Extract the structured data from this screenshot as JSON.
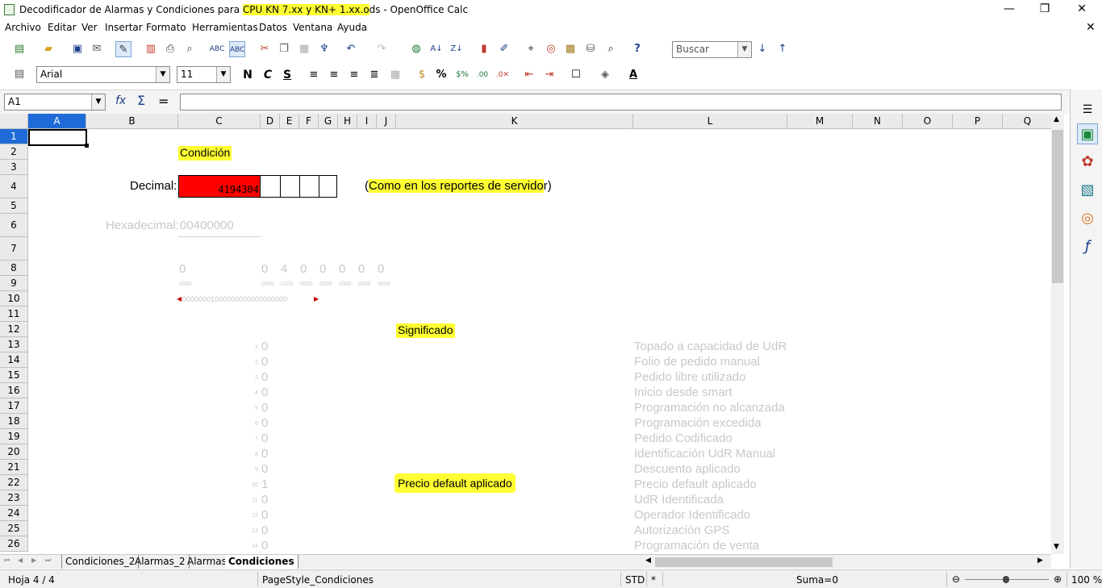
{
  "window": {
    "title_pre": "Decodificador de Alarmas y Condiciones para ",
    "title_hl": "CPU KN 7.xx y KN+ 1.xx.o",
    "title_post": "ds - OpenOffice Calc",
    "minimize": "—",
    "restore": "❐",
    "close": "✕",
    "doc_close": "✕"
  },
  "menu": [
    "Archivo",
    "Editar",
    "Ver",
    "Insertar",
    "Formato",
    "Herramientas",
    "Datos",
    "Ventana",
    "Ayuda"
  ],
  "toolbar": {
    "search_placeholder": "Buscar",
    "font_name": "Arial",
    "font_size": "11",
    "bold": "N",
    "italic": "C",
    "underline": "S",
    "percent": "%"
  },
  "formula": {
    "name_box": "A1",
    "fx": "fx",
    "sum": "Σ",
    "equals": "=",
    "content": ""
  },
  "columns": [
    "A",
    "B",
    "C",
    "D",
    "E",
    "F",
    "G",
    "H",
    "I",
    "J",
    "K",
    "L",
    "M",
    "N",
    "O",
    "P",
    "Q"
  ],
  "rows": [
    "1",
    "2",
    "3",
    "4",
    "5",
    "6",
    "7",
    "8",
    "9",
    "10",
    "11",
    "12",
    "13",
    "14",
    "15",
    "16",
    "17",
    "18",
    "19",
    "20",
    "21",
    "22",
    "23",
    "24",
    "25",
    "26"
  ],
  "sheet": {
    "condicion_label": "Condición",
    "decimal_label": "Decimal:",
    "decimal_value": "4194304",
    "note": "(Como en los reportes de servidor)",
    "note_hl": "Como en los reportes de servido",
    "hex_label": "Hexadecimal:",
    "hex_value": "00400000",
    "nibbles": [
      "0",
      "0",
      "4",
      "0",
      "0",
      "0",
      "0",
      "0"
    ],
    "nibble_bits": [
      "0000",
      "0000",
      "0100",
      "0000",
      "0000",
      "0000",
      "0000",
      "0000"
    ],
    "bit_string": "00000001000000000000000000",
    "significado_label": "Significado",
    "highlight_meaning": "Precio default aplicado",
    "bits": [
      {
        "idx": "1",
        "val": "0",
        "meaning": "Topado a capacidad de UdR"
      },
      {
        "idx": "2",
        "val": "0",
        "meaning": "Folio de pedido manual"
      },
      {
        "idx": "3",
        "val": "0",
        "meaning": "Pedido libre utilizado"
      },
      {
        "idx": "4",
        "val": "0",
        "meaning": "Inicio desde smart"
      },
      {
        "idx": "5",
        "val": "0",
        "meaning": "Programación no alcanzada"
      },
      {
        "idx": "6",
        "val": "0",
        "meaning": "Programación excedida"
      },
      {
        "idx": "7",
        "val": "0",
        "meaning": "Pedido Codificado"
      },
      {
        "idx": "8",
        "val": "0",
        "meaning": "Identificación UdR Manual"
      },
      {
        "idx": "9",
        "val": "0",
        "meaning": "Descuento aplicado"
      },
      {
        "idx": "10",
        "val": "1",
        "meaning": "Precio default aplicado"
      },
      {
        "idx": "11",
        "val": "0",
        "meaning": "UdR Identificada"
      },
      {
        "idx": "12",
        "val": "0",
        "meaning": "Operador Identificado"
      },
      {
        "idx": "13",
        "val": "0",
        "meaning": "Autorización GPS"
      },
      {
        "idx": "14",
        "val": "0",
        "meaning": "Programación de venta"
      }
    ]
  },
  "tabs": [
    "Condiciones_2",
    "Alarmas_2",
    "Alarmas",
    "Condiciones"
  ],
  "status": {
    "sheet": "Hoja 4 / 4",
    "page_style": "PageStyle_Condiciones",
    "mode": "STD",
    "modified": "*",
    "sum": "Suma=0",
    "zoom": "100 %"
  },
  "colors": {
    "highlight": "#ffff33",
    "decimal_fill": "#ff0000",
    "selection": "#1e6bd8",
    "faint_text": "#c8c8c8"
  }
}
